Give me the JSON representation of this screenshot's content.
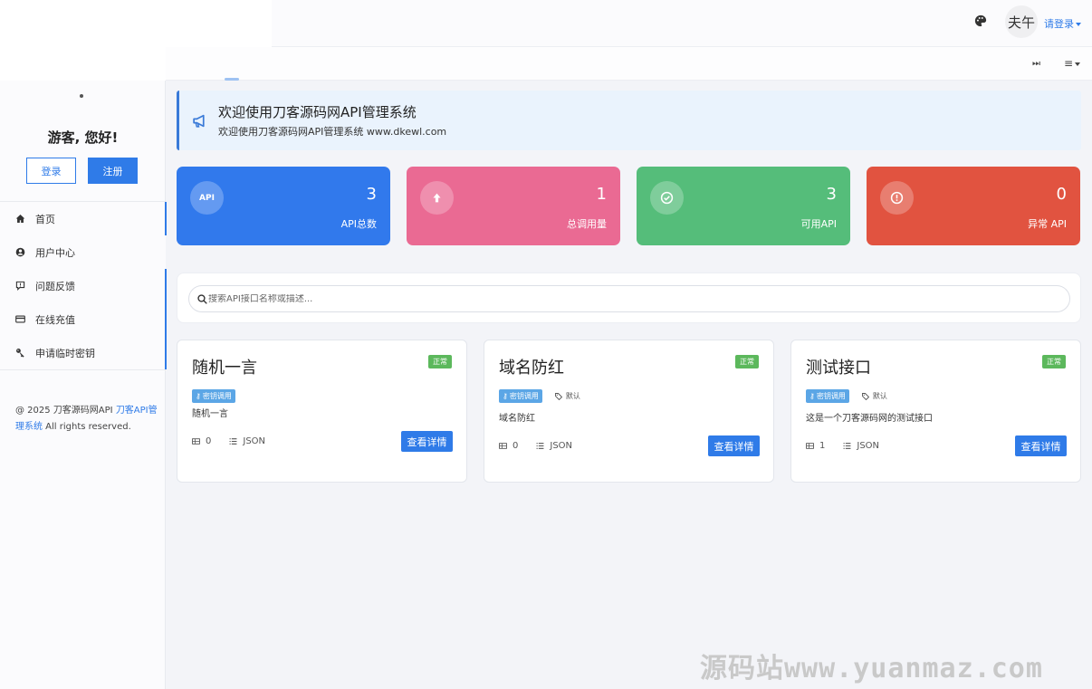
{
  "topbar": {
    "avatar_text": "夫午",
    "login_label": "请登录"
  },
  "sidebar": {
    "greeting": "游客, 您好!",
    "login_button": "登录",
    "register_button": "注册",
    "items": [
      {
        "label": "首页",
        "icon": "home-icon"
      },
      {
        "label": "用户中心",
        "icon": "user-circle-icon"
      },
      {
        "label": "问题反馈",
        "icon": "feedback-icon"
      },
      {
        "label": "在线充值",
        "icon": "credit-card-icon"
      },
      {
        "label": "申请临时密钥",
        "icon": "key-icon"
      }
    ],
    "footer": {
      "prefix": "@ 2025 刀客源码网API ",
      "link": "刀客API管理系统",
      "suffix": " All rights reserved."
    }
  },
  "notice": {
    "title": "欢迎使用刀客源码网API管理系统",
    "subtitle": "欢迎使用刀客源码网API管理系统 www.dkewl.com"
  },
  "stats": [
    {
      "value": "3",
      "label": "API总数",
      "icon_text": "API",
      "color": "#3179ec"
    },
    {
      "value": "1",
      "label": "总调用量",
      "icon_text": "",
      "color": "#ea6a93"
    },
    {
      "value": "3",
      "label": "可用API",
      "icon_text": "",
      "color": "#55bd7a"
    },
    {
      "value": "0",
      "label": "异常 API",
      "icon_text": "",
      "color": "#e15340"
    }
  ],
  "search": {
    "placeholder": "搜索API接口名称或描述..."
  },
  "apis": [
    {
      "title": "随机一言",
      "status": "正常",
      "tag_key": "密钥调用",
      "tag_default": "",
      "desc": "随机一言",
      "count": "0",
      "format": "JSON",
      "button": "查看详情"
    },
    {
      "title": "域名防红",
      "status": "正常",
      "tag_key": "密钥调用",
      "tag_default": "默认",
      "desc": "域名防红",
      "count": "0",
      "format": "JSON",
      "button": "查看详情"
    },
    {
      "title": "测试接口",
      "status": "正常",
      "tag_key": "密钥调用",
      "tag_default": "默认",
      "desc": "这是一个刀客源码网的测试接口",
      "count": "1",
      "format": "JSON",
      "button": "查看详情"
    }
  ],
  "watermark": "源码站www.yuanmaz.com"
}
